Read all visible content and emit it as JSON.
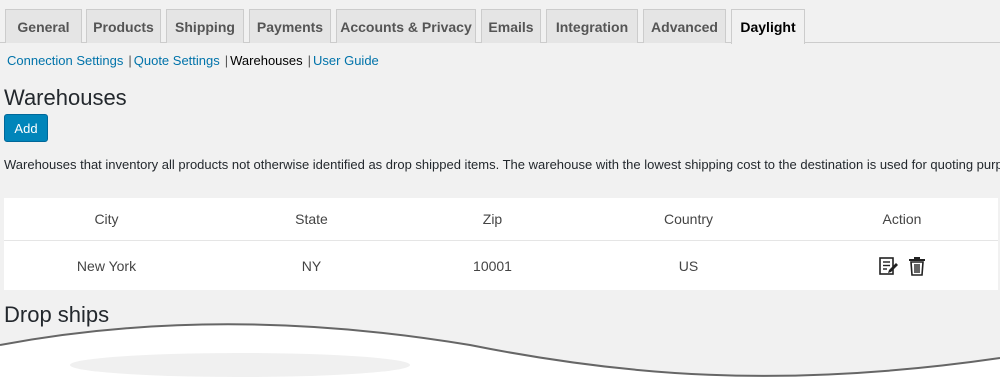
{
  "tabs": [
    "General",
    "Products",
    "Shipping",
    "Payments",
    "Accounts & Privacy",
    "Emails",
    "Integration",
    "Advanced",
    "Daylight"
  ],
  "active_tab": "Daylight",
  "subnav": {
    "connection": "Connection Settings",
    "quote": "Quote Settings",
    "warehouses": "Warehouses",
    "guide": "User Guide",
    "separator": "|"
  },
  "warehouses": {
    "title": "Warehouses",
    "add_label": "Add",
    "description": "Warehouses that inventory all products not otherwise identified as drop shipped items. The warehouse with the lowest shipping cost to the destination is used for quoting purposes.",
    "columns": [
      "City",
      "State",
      "Zip",
      "Country",
      "Action"
    ],
    "rows": [
      {
        "city": "New York",
        "state": "NY",
        "zip": "10001",
        "country": "US"
      }
    ],
    "action_icons": [
      "edit-icon",
      "trash-icon"
    ]
  },
  "dropships": {
    "title": "Drop ships"
  },
  "colors": {
    "accent": "#0085ba",
    "link": "#0073aa",
    "background": "#f1f1f1"
  }
}
